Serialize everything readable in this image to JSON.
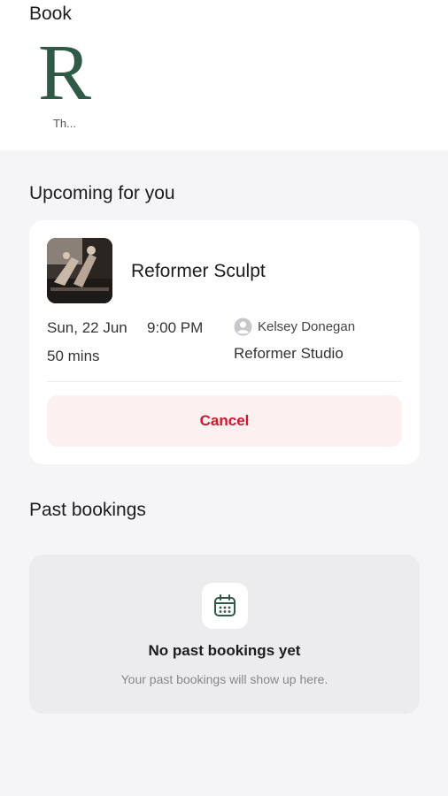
{
  "header": {
    "title": "Book"
  },
  "studio": {
    "logo_letter": "R",
    "name": "Th..."
  },
  "upcoming": {
    "heading": "Upcoming for you",
    "booking": {
      "class_name": "Reformer Sculpt",
      "date": "Sun, 22 Jun",
      "time": "9:00 PM",
      "duration": "50 mins",
      "instructor": "Kelsey Donegan",
      "location": "Reformer Studio",
      "cancel_label": "Cancel"
    }
  },
  "past": {
    "heading": "Past bookings",
    "empty_title": "No past bookings yet",
    "empty_subtitle": "Your past bookings will show up here."
  },
  "colors": {
    "brand_green": "#2f5a45",
    "cancel_red": "#d1172b",
    "cancel_bg": "#fdf0f0"
  },
  "icons": [
    "studio-logo",
    "user-icon",
    "calendar-icon"
  ]
}
